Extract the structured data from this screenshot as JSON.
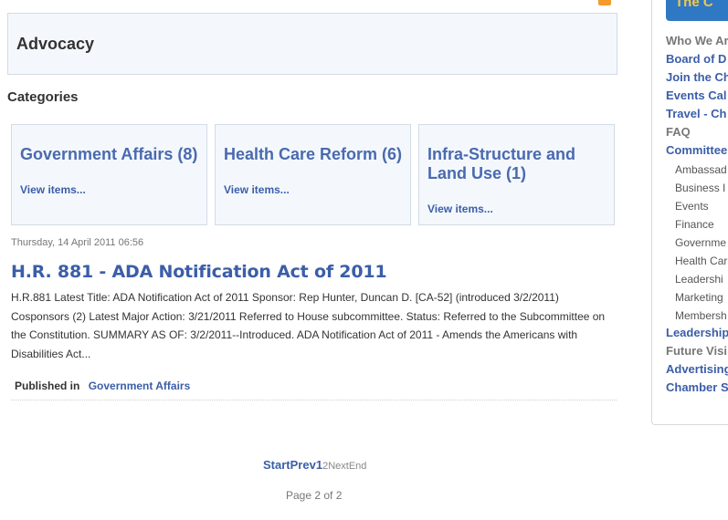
{
  "header": {
    "title": "Advocacy"
  },
  "categories": {
    "heading": "Categories",
    "items": [
      {
        "title": "Government Affairs (8)",
        "link": "View items..."
      },
      {
        "title": "Health Care Reform (6)",
        "link": "View items..."
      },
      {
        "title": "Infra-Structure and Land Use (1)",
        "link": "View items..."
      }
    ]
  },
  "article": {
    "date": "Thursday, 14 April 2011 06:56",
    "title": "H.R. 881 - ADA Notification Act of 2011",
    "body": "H.R.881 Latest Title: ADA Notification Act of 2011 Sponsor: Rep Hunter, Duncan D. [CA-52] (introduced 3/2/2011) Cosponsors (2) Latest Major Action: 3/21/2011 Referred to House subcommittee. Status: Referred to the Subcommittee on the Constitution. SUMMARY AS OF: 3/2/2011--Introduced. ADA Notification Act of 2011 - Amends the Americans with Disabilities Act...",
    "published_label": "Published in",
    "published_category": "Government Affairs"
  },
  "pagination": {
    "start": "Start",
    "prev": "Prev",
    "page1": "1",
    "page2": "2",
    "next": "Next",
    "end": "End",
    "counter": "Page 2 of 2"
  },
  "sidebar": {
    "banner": "The C",
    "items": [
      {
        "label": "Who We Ar",
        "level": "main",
        "style": "grey"
      },
      {
        "label": "Board of D",
        "level": "main"
      },
      {
        "label": "Join the Ch",
        "level": "main"
      },
      {
        "label": "Events Cal",
        "level": "main"
      },
      {
        "label": "Travel - Ch",
        "level": "main"
      },
      {
        "label": "FAQ",
        "level": "main",
        "style": "grey"
      },
      {
        "label": "Committee",
        "level": "main"
      },
      {
        "label": "Ambassad",
        "level": "sub"
      },
      {
        "label": "Business I",
        "level": "sub"
      },
      {
        "label": "Events",
        "level": "sub"
      },
      {
        "label": "Finance",
        "level": "sub"
      },
      {
        "label": "Governme",
        "level": "sub"
      },
      {
        "label": "Health Car",
        "level": "sub"
      },
      {
        "label": "Leadershi",
        "level": "sub"
      },
      {
        "label": "Marketing",
        "level": "sub"
      },
      {
        "label": "Membersh",
        "level": "sub"
      },
      {
        "label": "Leadership",
        "level": "main"
      },
      {
        "label": "Future Visi",
        "level": "main",
        "style": "grey"
      },
      {
        "label": "Advertising",
        "level": "main"
      },
      {
        "label": "Chamber S",
        "level": "main"
      }
    ]
  }
}
